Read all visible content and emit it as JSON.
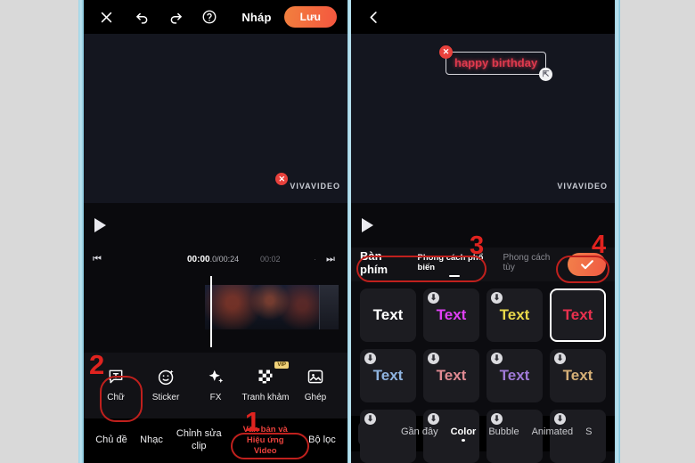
{
  "app": {
    "watermark": "VIVAVIDEO"
  },
  "left_panel": {
    "topbar": {
      "close_icon": "close-icon",
      "undo_icon": "undo-icon",
      "redo_icon": "redo-icon",
      "help_icon": "help-icon",
      "draft_label": "Nháp",
      "save_label": "Lưu",
      "save_color": "#f2803e"
    },
    "player": {
      "play_icon": "play-icon"
    },
    "ruler": {
      "prev_icon": "skip-previous-icon",
      "next_icon": "skip-next-icon",
      "current_time": "00:00",
      "current_frac": ".0",
      "total_time": "/00:24",
      "mark_time": "00:02",
      "tick": "·"
    },
    "tools": [
      {
        "label": "Chữ",
        "icon": "text-bubble-icon",
        "vip": ""
      },
      {
        "label": "Sticker",
        "icon": "sticker-face-icon",
        "vip": ""
      },
      {
        "label": "FX",
        "icon": "sparkle-icon",
        "vip": ""
      },
      {
        "label": "Tranh khảm",
        "icon": "mosaic-icon",
        "vip": "VIP"
      },
      {
        "label": "Ghép",
        "icon": "picture-in-picture-icon",
        "vip": ""
      }
    ],
    "bottom_nav": [
      {
        "label": "Chủ đề",
        "highlight": false
      },
      {
        "label": "Nhạc",
        "highlight": false
      },
      {
        "label": "Chỉnh sửa clip",
        "highlight": false
      },
      {
        "label": "Văn bản và Hiệu ứng Video",
        "highlight": true
      },
      {
        "label": "Bộ lọc",
        "highlight": false
      }
    ]
  },
  "right_panel": {
    "topbar": {
      "back_icon": "back-chevron-icon"
    },
    "player": {
      "play_icon": "play-icon"
    },
    "text_overlay": {
      "value": "happy birthday",
      "color": "#e03a4e",
      "delete_icon": "close-icon",
      "resize_icon": "resize-handle-icon"
    },
    "style_tabs": [
      {
        "label": "Bàn phím",
        "active": false,
        "main": true
      },
      {
        "label": "Phong cách phổ biến",
        "active": true,
        "main": false
      },
      {
        "label": "Phong cách tùy",
        "active": false,
        "main": false
      }
    ],
    "confirm": {
      "icon": "check-icon",
      "color": "#f2804a"
    },
    "style_grid": [
      {
        "text": "Text",
        "color": "#ffffff",
        "download": false,
        "selected": false
      },
      {
        "text": "Text",
        "color": "#e040f5",
        "download": true,
        "selected": false
      },
      {
        "text": "Text",
        "color": "#e8d84a",
        "download": true,
        "selected": false
      },
      {
        "text": "Text",
        "color": "#e8314e",
        "download": false,
        "selected": true
      },
      {
        "text": "Text",
        "color": "#8fb4e0",
        "download": true,
        "selected": false
      },
      {
        "text": "Text",
        "color": "#e08a92",
        "download": true,
        "selected": false
      },
      {
        "text": "Text",
        "color": "#a07ad8",
        "download": true,
        "selected": false
      },
      {
        "text": "Text",
        "color": "#d6b077",
        "download": true,
        "selected": false
      },
      {
        "text": "",
        "color": "#1c1c21",
        "download": true,
        "selected": false
      },
      {
        "text": "",
        "color": "#1c1c21",
        "download": true,
        "selected": false
      },
      {
        "text": "",
        "color": "#1c1c21",
        "download": true,
        "selected": false
      },
      {
        "text": "",
        "color": "#1c1c21",
        "download": true,
        "selected": false
      }
    ],
    "bottom_tabs": {
      "store_icon": "store-icon",
      "items": [
        {
          "label": "Gần đây",
          "active": false
        },
        {
          "label": "Color",
          "active": true
        },
        {
          "label": "Bubble",
          "active": false
        },
        {
          "label": "Animated",
          "active": false
        },
        {
          "label": "S",
          "active": false
        }
      ]
    }
  },
  "annotations": [
    {
      "number": "1"
    },
    {
      "number": "2"
    },
    {
      "number": "3"
    },
    {
      "number": "4"
    }
  ]
}
